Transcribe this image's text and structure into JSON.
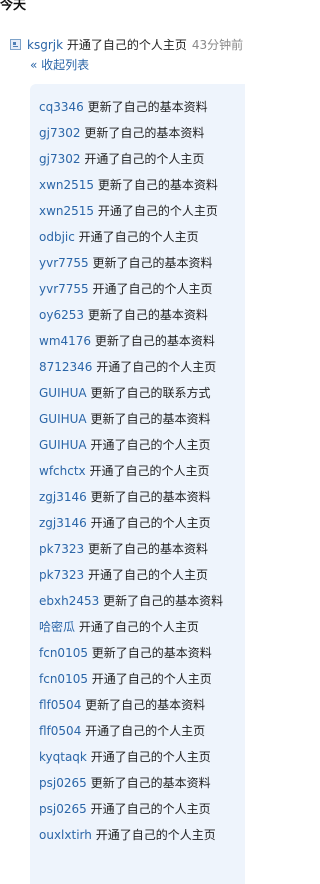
{
  "section_heading": "今天",
  "entry": {
    "user": "ksgrjk",
    "action": "开通了自己的个人主页",
    "time": "43分钟前",
    "icon": "feed-icon"
  },
  "collapse_label": "« 收起列表",
  "items": [
    {
      "user": "cq3346",
      "action": "更新了自己的基本资料"
    },
    {
      "user": "gj7302",
      "action": "更新了自己的基本资料"
    },
    {
      "user": "gj7302",
      "action": "开通了自己的个人主页"
    },
    {
      "user": "xwn2515",
      "action": "更新了自己的基本资料"
    },
    {
      "user": "xwn2515",
      "action": "开通了自己的个人主页"
    },
    {
      "user": "odbjic",
      "action": "开通了自己的个人主页"
    },
    {
      "user": "yvr7755",
      "action": "更新了自己的基本资料"
    },
    {
      "user": "yvr7755",
      "action": "开通了自己的个人主页"
    },
    {
      "user": "oy6253",
      "action": "更新了自己的基本资料"
    },
    {
      "user": "wm4176",
      "action": "更新了自己的基本资料"
    },
    {
      "user": "8712346",
      "action": "开通了自己的个人主页"
    },
    {
      "user": "GUIHUA",
      "action": "更新了自己的联系方式"
    },
    {
      "user": "GUIHUA",
      "action": "更新了自己的基本资料"
    },
    {
      "user": "GUIHUA",
      "action": "开通了自己的个人主页"
    },
    {
      "user": "wfchctx",
      "action": "开通了自己的个人主页"
    },
    {
      "user": "zgj3146",
      "action": "更新了自己的基本资料"
    },
    {
      "user": "zgj3146",
      "action": "开通了自己的个人主页"
    },
    {
      "user": "pk7323",
      "action": "更新了自己的基本资料"
    },
    {
      "user": "pk7323",
      "action": "开通了自己的个人主页"
    },
    {
      "user": "ebxh2453",
      "action": "更新了自己的基本资料"
    },
    {
      "user": "哈密瓜",
      "action": "开通了自己的个人主页"
    },
    {
      "user": "fcn0105",
      "action": "更新了自己的基本资料"
    },
    {
      "user": "fcn0105",
      "action": "开通了自己的个人主页"
    },
    {
      "user": "flf0504",
      "action": "更新了自己的基本资料"
    },
    {
      "user": "flf0504",
      "action": "开通了自己的个人主页"
    },
    {
      "user": "kyqtaqk",
      "action": "开通了自己的个人主页"
    },
    {
      "user": "psj0265",
      "action": "更新了自己的基本资料"
    },
    {
      "user": "psj0265",
      "action": "开通了自己的个人主页"
    },
    {
      "user": "ouxlxtirh",
      "action": "开通了自己的个人主页"
    }
  ]
}
